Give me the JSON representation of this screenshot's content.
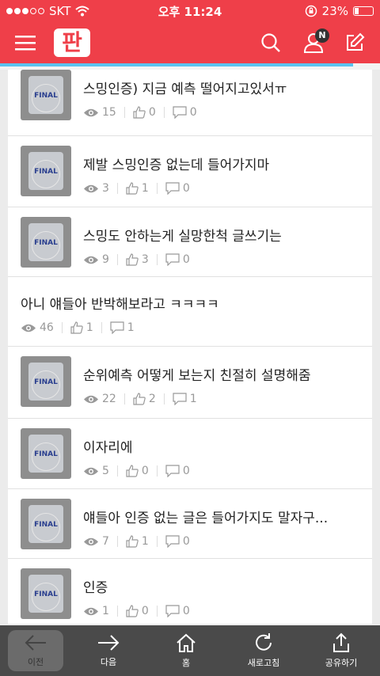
{
  "status": {
    "carrier": "SKT",
    "time": "오후 11:24",
    "battery": "23%"
  },
  "app": {
    "logo_text": "판",
    "notification_badge": "N",
    "scroll_progress": 0.93
  },
  "posts": [
    {
      "title": "스밍인증) 지금 예측 떨어지고있서ㅠ",
      "views": "15",
      "likes": "0",
      "comments": "0",
      "thumb": true
    },
    {
      "title": "제발 스밍인증 없는데 들어가지마",
      "views": "3",
      "likes": "1",
      "comments": "0",
      "thumb": true
    },
    {
      "title": "스밍도 안하는게 실망한척 글쓰기는",
      "views": "9",
      "likes": "3",
      "comments": "0",
      "thumb": true
    },
    {
      "title": "아니 얘들아 반박해보라고 ㅋㅋㅋㅋ",
      "views": "46",
      "likes": "1",
      "comments": "1",
      "thumb": false
    },
    {
      "title": "순위예측 어떻게 보는지 친절히 설명해줌",
      "views": "22",
      "likes": "2",
      "comments": "1",
      "thumb": true
    },
    {
      "title": "이자리에",
      "views": "5",
      "likes": "0",
      "comments": "0",
      "thumb": true
    },
    {
      "title": "얘들아 인증 없는 글은 들어가지도 말자구...",
      "views": "7",
      "likes": "1",
      "comments": "0",
      "thumb": true
    },
    {
      "title": "인증",
      "views": "1",
      "likes": "0",
      "comments": "0",
      "thumb": true
    }
  ],
  "thumb_label": "FINAL",
  "thumb_hand_text": "네이트판",
  "toolbar": {
    "back": "이전",
    "next": "다음",
    "home": "홈",
    "refresh": "새로고침",
    "share": "공유하기"
  },
  "colors": {
    "brand": "#ef3f49",
    "progress": "#5bc2ee",
    "toolbar": "#4a4a4a"
  }
}
